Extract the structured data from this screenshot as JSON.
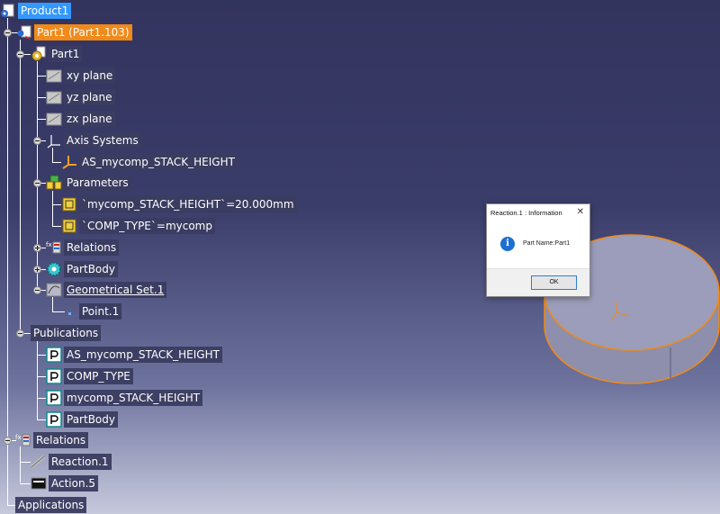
{
  "tree": {
    "product": "Product1",
    "part_instance": "Part1 (Part1.103)",
    "part": "Part1",
    "planes": [
      "xy plane",
      "yz plane",
      "zx plane"
    ],
    "axis_systems": "Axis Systems",
    "axis_item": "AS_mycomp_STACK_HEIGHT",
    "parameters": "Parameters",
    "param_items": [
      "`mycomp_STACK_HEIGHT`=20.000mm",
      "`COMP_TYPE`=mycomp"
    ],
    "relations_part": "Relations",
    "partbody": "PartBody",
    "geo_set": "Geometrical Set.1",
    "point": "Point.1",
    "publications": "Publications",
    "pub_items": [
      "AS_mycomp_STACK_HEIGHT",
      "COMP_TYPE",
      "mycomp_STACK_HEIGHT",
      "PartBody"
    ],
    "relations_root": "Relations",
    "reaction": "Reaction.1",
    "action": "Action.5",
    "applications": "Applications"
  },
  "dialog": {
    "title": "Reaction.1 : Information",
    "message": "Part Name:Part1",
    "ok_label": "OK",
    "close_glyph": "✕",
    "info_glyph": "i"
  },
  "colors": {
    "selection": "#3399ff",
    "highlight": "#f08a1a",
    "part_top": "#9b9dba",
    "part_edge": "#f08a1a"
  }
}
